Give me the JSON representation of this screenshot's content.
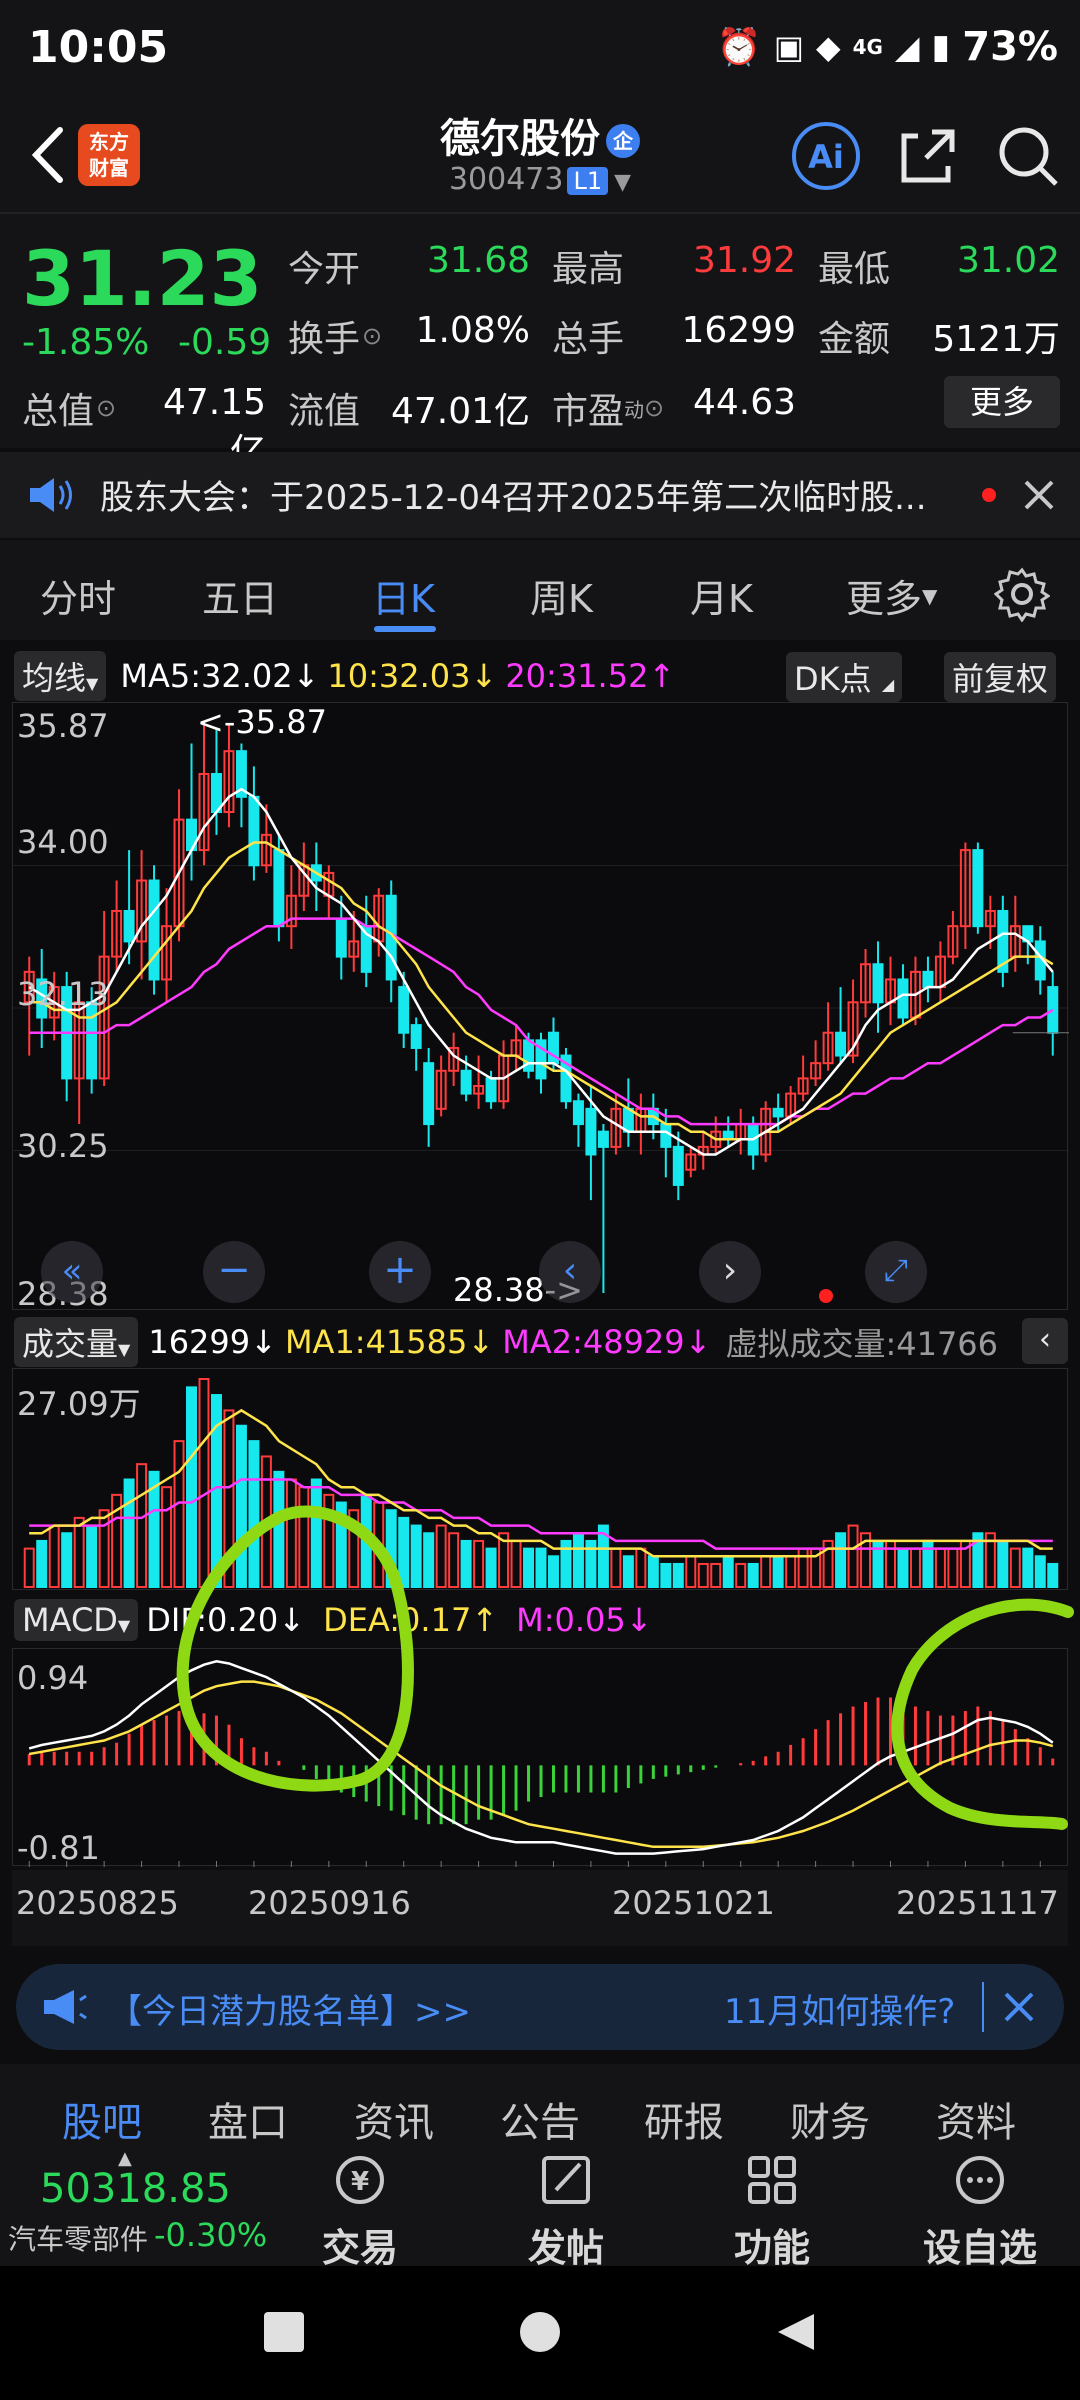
{
  "status": {
    "time": "10:05",
    "battery": "73%",
    "net": "4G"
  },
  "header": {
    "logo_line1": "东方",
    "logo_line2": "财富",
    "name": "德尔股份",
    "badge": "企",
    "code": "300473",
    "level": "L1"
  },
  "quote": {
    "price": "31.23",
    "pct": "-1.85%",
    "chg": "-0.59",
    "items": [
      {
        "label": "今开",
        "value": "31.68",
        "color": "#2bd95b"
      },
      {
        "label": "最高",
        "value": "31.92",
        "color": "#ff3b3b"
      },
      {
        "label": "最低",
        "value": "31.02",
        "color": "#2bd95b"
      },
      {
        "label": "换手",
        "value": "1.08%",
        "color": "#ffffff"
      },
      {
        "label": "总手",
        "value": "16299",
        "color": "#ffffff"
      },
      {
        "label": "金额",
        "value": "5121万",
        "color": "#ffffff"
      },
      {
        "label": "总值",
        "value": "47.15亿",
        "color": "#ffffff"
      },
      {
        "label": "流值",
        "value": "47.01亿",
        "color": "#ffffff"
      },
      {
        "label": "市盈",
        "sup": "动",
        "value": "44.63",
        "color": "#ffffff"
      }
    ],
    "more": "更多"
  },
  "notice": {
    "text": "股东大会：于2025-12-04召开2025年第二次临时股..."
  },
  "tabs": [
    "分时",
    "五日",
    "日K",
    "周K",
    "月K",
    "更多"
  ],
  "active_tab": "日K",
  "ma_row": {
    "selector": "均线",
    "ma5": "MA5:32.02",
    "ma10": "10:32.03",
    "ma20": "20:31.52",
    "dk": "DK点",
    "fq": "前复权"
  },
  "vol_row": {
    "selector": "成交量",
    "vol": "16299",
    "ma1": "MA1:41585",
    "ma2": "MA2:48929",
    "virtual": "虚拟成交量:41766"
  },
  "macd_row": {
    "selector": "MACD",
    "dif": "DIF:0.20",
    "dea": "DEA:0.17",
    "m": "M:0.05"
  },
  "chart_data": {
    "type": "candlestick",
    "ylim": [
      28.38,
      35.87
    ],
    "ytick_labels": [
      "35.87",
      "34.00",
      "32.13",
      "30.25",
      "28.38"
    ],
    "max_marker": "<-35.87",
    "min_marker": "28.38->",
    "x_tick_labels": [
      "20250825",
      "20250916",
      "20251021",
      "20251117"
    ],
    "candles": [
      [
        32.2,
        32.6,
        31.5,
        32.8
      ],
      [
        32.5,
        32.0,
        31.6,
        32.9
      ],
      [
        32.0,
        32.4,
        31.7,
        32.6
      ],
      [
        32.4,
        31.2,
        30.9,
        32.6
      ],
      [
        31.2,
        32.2,
        30.6,
        32.4
      ],
      [
        32.2,
        31.2,
        31.0,
        32.4
      ],
      [
        31.2,
        32.8,
        31.1,
        33.4
      ],
      [
        32.8,
        33.4,
        32.6,
        33.8
      ],
      [
        33.4,
        33.0,
        32.7,
        34.2
      ],
      [
        33.0,
        33.8,
        32.5,
        34.2
      ],
      [
        33.8,
        32.5,
        32.3,
        34.0
      ],
      [
        32.5,
        33.2,
        32.2,
        33.7
      ],
      [
        33.2,
        34.6,
        33.0,
        35.0
      ],
      [
        34.6,
        34.2,
        33.8,
        35.6
      ],
      [
        34.2,
        35.2,
        34.0,
        35.9
      ],
      [
        35.2,
        34.7,
        34.4,
        35.8
      ],
      [
        34.7,
        35.5,
        34.5,
        35.87
      ],
      [
        35.5,
        34.9,
        34.5,
        35.6
      ],
      [
        34.9,
        34.0,
        33.8,
        35.3
      ],
      [
        34.0,
        34.4,
        33.9,
        34.8
      ],
      [
        34.2,
        33.2,
        33.0,
        34.4
      ],
      [
        33.2,
        33.6,
        32.9,
        34.0
      ],
      [
        33.6,
        34.0,
        33.4,
        34.3
      ],
      [
        34.0,
        33.8,
        33.4,
        34.3
      ],
      [
        33.6,
        33.9,
        33.3,
        34.0
      ],
      [
        33.3,
        32.8,
        32.5,
        33.6
      ],
      [
        32.8,
        33.0,
        32.6,
        33.4
      ],
      [
        33.2,
        32.6,
        32.4,
        33.6
      ],
      [
        33.0,
        33.6,
        32.8,
        33.7
      ],
      [
        33.6,
        32.5,
        32.2,
        33.8
      ],
      [
        32.4,
        31.8,
        31.6,
        32.6
      ],
      [
        31.9,
        31.6,
        31.3,
        32.0
      ],
      [
        31.4,
        30.6,
        30.3,
        31.6
      ],
      [
        30.8,
        31.3,
        30.7,
        31.5
      ],
      [
        31.3,
        31.6,
        31.1,
        31.8
      ],
      [
        31.3,
        31.0,
        30.9,
        31.5
      ],
      [
        31.0,
        31.1,
        30.8,
        31.5
      ],
      [
        31.2,
        30.9,
        30.8,
        31.3
      ],
      [
        30.9,
        31.5,
        30.8,
        31.7
      ],
      [
        31.5,
        31.7,
        31.3,
        31.9
      ],
      [
        31.7,
        31.3,
        31.2,
        31.8
      ],
      [
        31.7,
        31.2,
        31.0,
        31.8
      ],
      [
        31.8,
        31.4,
        31.3,
        32.0
      ],
      [
        31.5,
        30.9,
        30.8,
        31.6
      ],
      [
        30.9,
        30.6,
        30.3,
        31.0
      ],
      [
        30.8,
        30.2,
        29.6,
        31.1
      ],
      [
        30.5,
        30.3,
        28.38,
        30.6
      ],
      [
        30.3,
        30.8,
        30.2,
        31.0
      ],
      [
        30.8,
        30.5,
        30.3,
        31.2
      ],
      [
        30.5,
        30.8,
        30.2,
        31.0
      ],
      [
        30.8,
        30.6,
        30.4,
        31.0
      ],
      [
        30.6,
        30.3,
        29.9,
        30.8
      ],
      [
        30.3,
        29.8,
        29.6,
        30.5
      ],
      [
        30.0,
        30.2,
        29.9,
        30.3
      ],
      [
        30.2,
        30.3,
        30.0,
        30.5
      ],
      [
        30.3,
        30.5,
        30.2,
        30.7
      ],
      [
        30.5,
        30.4,
        30.3,
        30.7
      ],
      [
        30.4,
        30.6,
        30.2,
        30.8
      ],
      [
        30.6,
        30.2,
        30.0,
        30.7
      ],
      [
        30.2,
        30.8,
        30.1,
        30.9
      ],
      [
        30.8,
        30.7,
        30.5,
        31.0
      ],
      [
        30.7,
        31.0,
        30.6,
        31.1
      ],
      [
        31.0,
        31.2,
        30.9,
        31.5
      ],
      [
        31.2,
        31.4,
        31.1,
        31.7
      ],
      [
        31.4,
        31.8,
        31.3,
        32.2
      ],
      [
        31.8,
        31.5,
        31.4,
        32.4
      ],
      [
        31.5,
        32.2,
        31.4,
        32.5
      ],
      [
        32.2,
        32.7,
        32.0,
        32.9
      ],
      [
        32.7,
        32.2,
        31.8,
        33.0
      ],
      [
        32.2,
        32.5,
        31.9,
        32.8
      ],
      [
        32.5,
        32.0,
        31.9,
        32.7
      ],
      [
        32.0,
        32.6,
        31.9,
        32.8
      ],
      [
        32.6,
        32.4,
        32.2,
        32.8
      ],
      [
        32.4,
        32.8,
        32.2,
        33.0
      ],
      [
        32.8,
        33.2,
        32.7,
        33.4
      ],
      [
        33.2,
        34.2,
        32.9,
        34.3
      ],
      [
        34.2,
        33.2,
        33.1,
        34.3
      ],
      [
        33.2,
        33.4,
        32.9,
        33.6
      ],
      [
        33.4,
        32.6,
        32.4,
        33.6
      ],
      [
        32.8,
        33.2,
        32.6,
        33.6
      ],
      [
        33.2,
        33.0,
        32.7,
        33.2
      ],
      [
        33.0,
        32.5,
        32.3,
        33.2
      ],
      [
        32.4,
        31.8,
        31.5,
        32.6
      ]
    ],
    "ma5": [
      32.4,
      32.3,
      32.2,
      32.1,
      32.1,
      32.2,
      32.3,
      32.6,
      32.9,
      33.2,
      33.4,
      33.6,
      33.9,
      34.2,
      34.5,
      34.7,
      34.9,
      35.0,
      34.9,
      34.7,
      34.4,
      34.1,
      33.9,
      33.7,
      33.6,
      33.5,
      33.3,
      33.1,
      33.0,
      32.8,
      32.5,
      32.2,
      31.9,
      31.7,
      31.5,
      31.4,
      31.3,
      31.2,
      31.2,
      31.3,
      31.4,
      31.4,
      31.4,
      31.3,
      31.1,
      30.9,
      30.7,
      30.6,
      30.5,
      30.5,
      30.5,
      30.5,
      30.4,
      30.3,
      30.2,
      30.2,
      30.3,
      30.4,
      30.4,
      30.5,
      30.6,
      30.7,
      30.8,
      31.0,
      31.2,
      31.4,
      31.6,
      31.9,
      32.1,
      32.2,
      32.3,
      32.3,
      32.4,
      32.4,
      32.5,
      32.7,
      32.9,
      33.0,
      33.1,
      33.1,
      33.0,
      32.8,
      32.6
    ],
    "ma10": [
      32.2,
      32.2,
      32.1,
      32.1,
      32.0,
      32.0,
      32.1,
      32.2,
      32.4,
      32.6,
      32.8,
      33.0,
      33.2,
      33.4,
      33.7,
      33.9,
      34.1,
      34.2,
      34.3,
      34.3,
      34.2,
      34.1,
      34.0,
      33.9,
      33.8,
      33.7,
      33.5,
      33.4,
      33.2,
      33.1,
      32.9,
      32.7,
      32.4,
      32.2,
      32.0,
      31.8,
      31.7,
      31.6,
      31.5,
      31.5,
      31.4,
      31.4,
      31.3,
      31.3,
      31.2,
      31.1,
      31.0,
      30.9,
      30.8,
      30.7,
      30.7,
      30.6,
      30.6,
      30.5,
      30.5,
      30.4,
      30.4,
      30.4,
      30.4,
      30.5,
      30.5,
      30.6,
      30.7,
      30.8,
      30.9,
      31.0,
      31.2,
      31.4,
      31.6,
      31.8,
      31.9,
      32.0,
      32.1,
      32.2,
      32.3,
      32.4,
      32.5,
      32.6,
      32.7,
      32.8,
      32.8,
      32.8,
      32.7
    ],
    "ma20": [
      31.8,
      31.8,
      31.8,
      31.8,
      31.8,
      31.8,
      31.8,
      31.9,
      31.9,
      32.0,
      32.1,
      32.2,
      32.3,
      32.4,
      32.6,
      32.7,
      32.9,
      33.0,
      33.1,
      33.2,
      33.2,
      33.3,
      33.3,
      33.3,
      33.3,
      33.3,
      33.3,
      33.2,
      33.2,
      33.1,
      33.0,
      32.9,
      32.8,
      32.7,
      32.6,
      32.4,
      32.3,
      32.1,
      32.0,
      31.9,
      31.7,
      31.6,
      31.5,
      31.4,
      31.3,
      31.2,
      31.1,
      31.0,
      30.9,
      30.8,
      30.8,
      30.7,
      30.7,
      30.6,
      30.6,
      30.6,
      30.6,
      30.6,
      30.6,
      30.6,
      30.6,
      30.7,
      30.7,
      30.8,
      30.8,
      30.9,
      31.0,
      31.0,
      31.1,
      31.2,
      31.2,
      31.3,
      31.4,
      31.4,
      31.5,
      31.6,
      31.7,
      31.8,
      31.9,
      31.9,
      32.0,
      32.0,
      32.1
    ],
    "volume_ylabel": "27.09万",
    "volume_max": 27.09,
    "volumes": [
      5,
      6,
      8,
      7,
      9,
      8,
      10,
      12,
      14,
      16,
      15,
      13,
      19,
      26,
      27.09,
      25,
      23,
      21,
      19,
      17,
      15,
      14,
      13,
      14,
      12,
      11,
      10,
      12,
      11,
      10,
      9,
      8,
      7,
      8,
      7,
      6,
      6,
      5,
      7,
      6,
      5,
      5,
      4,
      6,
      7,
      6,
      8,
      5,
      4,
      5,
      4,
      3,
      3,
      4,
      3,
      3,
      4,
      3,
      3,
      4,
      4,
      4,
      5,
      5,
      6,
      7,
      8,
      7,
      6,
      6,
      5,
      5,
      6,
      5,
      5,
      6,
      7,
      7,
      6,
      5,
      5,
      4,
      3
    ],
    "vol_ma1": [
      7,
      7,
      8,
      8,
      8,
      9,
      9,
      10,
      11,
      12,
      13,
      14,
      15,
      17,
      19,
      21,
      22,
      23,
      22,
      21,
      19,
      18,
      17,
      16,
      14,
      13,
      13,
      12,
      12,
      11,
      10,
      10,
      9,
      9,
      8,
      8,
      7,
      7,
      6,
      6,
      6,
      6,
      5,
      5,
      5,
      5,
      5,
      5,
      5,
      5,
      4,
      4,
      4,
      4,
      4,
      4,
      4,
      4,
      4,
      4,
      4,
      4,
      4,
      4,
      5,
      5,
      5,
      6,
      6,
      6,
      6,
      6,
      6,
      6,
      6,
      6,
      6,
      6,
      6,
      6,
      6,
      5,
      5
    ],
    "vol_ma2": [
      8,
      8,
      8,
      8,
      8,
      8,
      8,
      9,
      9,
      9,
      10,
      10,
      11,
      11,
      12,
      13,
      13,
      14,
      14,
      14,
      14,
      14,
      13,
      13,
      13,
      12,
      12,
      12,
      11,
      11,
      11,
      10,
      10,
      10,
      9,
      9,
      9,
      8,
      8,
      8,
      8,
      7,
      7,
      7,
      7,
      7,
      7,
      6,
      6,
      6,
      6,
      6,
      6,
      6,
      6,
      5,
      5,
      5,
      5,
      5,
      5,
      5,
      5,
      5,
      5,
      5,
      5,
      5,
      5,
      5,
      5,
      5,
      5,
      5,
      5,
      5,
      6,
      6,
      6,
      6,
      6,
      6,
      6
    ],
    "macd_ylim": [
      -0.81,
      0.94
    ],
    "macd_ytick_labels": [
      "0.94",
      "-0.81"
    ],
    "dif": [
      0.15,
      0.18,
      0.2,
      0.22,
      0.24,
      0.26,
      0.3,
      0.36,
      0.44,
      0.54,
      0.62,
      0.7,
      0.78,
      0.84,
      0.89,
      0.92,
      0.9,
      0.86,
      0.82,
      0.78,
      0.72,
      0.66,
      0.6,
      0.52,
      0.44,
      0.34,
      0.24,
      0.14,
      0.04,
      -0.06,
      -0.16,
      -0.26,
      -0.36,
      -0.44,
      -0.5,
      -0.56,
      -0.6,
      -0.64,
      -0.66,
      -0.68,
      -0.68,
      -0.68,
      -0.68,
      -0.7,
      -0.72,
      -0.74,
      -0.76,
      -0.78,
      -0.78,
      -0.78,
      -0.78,
      -0.77,
      -0.76,
      -0.75,
      -0.74,
      -0.72,
      -0.7,
      -0.68,
      -0.66,
      -0.62,
      -0.58,
      -0.52,
      -0.46,
      -0.38,
      -0.3,
      -0.22,
      -0.14,
      -0.06,
      0.02,
      0.08,
      0.12,
      0.16,
      0.2,
      0.24,
      0.28,
      0.34,
      0.4,
      0.42,
      0.4,
      0.38,
      0.34,
      0.28,
      0.2
    ],
    "dea": [
      0.1,
      0.12,
      0.14,
      0.16,
      0.18,
      0.2,
      0.22,
      0.26,
      0.3,
      0.36,
      0.42,
      0.48,
      0.54,
      0.6,
      0.66,
      0.7,
      0.72,
      0.74,
      0.74,
      0.72,
      0.7,
      0.66,
      0.62,
      0.58,
      0.52,
      0.46,
      0.38,
      0.3,
      0.22,
      0.14,
      0.06,
      -0.02,
      -0.1,
      -0.18,
      -0.24,
      -0.3,
      -0.36,
      -0.4,
      -0.44,
      -0.48,
      -0.52,
      -0.54,
      -0.56,
      -0.58,
      -0.6,
      -0.62,
      -0.64,
      -0.66,
      -0.68,
      -0.7,
      -0.72,
      -0.72,
      -0.72,
      -0.72,
      -0.72,
      -0.71,
      -0.7,
      -0.69,
      -0.68,
      -0.66,
      -0.64,
      -0.61,
      -0.58,
      -0.54,
      -0.5,
      -0.45,
      -0.4,
      -0.34,
      -0.28,
      -0.22,
      -0.16,
      -0.1,
      -0.04,
      0.02,
      0.06,
      0.1,
      0.14,
      0.18,
      0.2,
      0.22,
      0.22,
      0.2,
      0.17
    ],
    "macd_colors": {
      "up": "#ff3b3b",
      "down": "#16e8ee",
      "ma5": "#ffffff",
      "ma10": "#ffe34a",
      "ma20": "#ff3bff",
      "macd_pos": "#ff3b3b",
      "macd_neg": "#3ad43a"
    }
  },
  "banner": {
    "left": "【今日潜力股名单】>>",
    "right": "11月如何操作?"
  },
  "bottom_tabs": [
    "股吧",
    "盘口",
    "资讯",
    "公告",
    "研报",
    "财务",
    "资料"
  ],
  "index": {
    "value": "50318.85",
    "name": "汽车零部件",
    "pct": "-0.30%"
  },
  "toolbar": [
    "交易",
    "发帖",
    "功能",
    "设自选"
  ]
}
